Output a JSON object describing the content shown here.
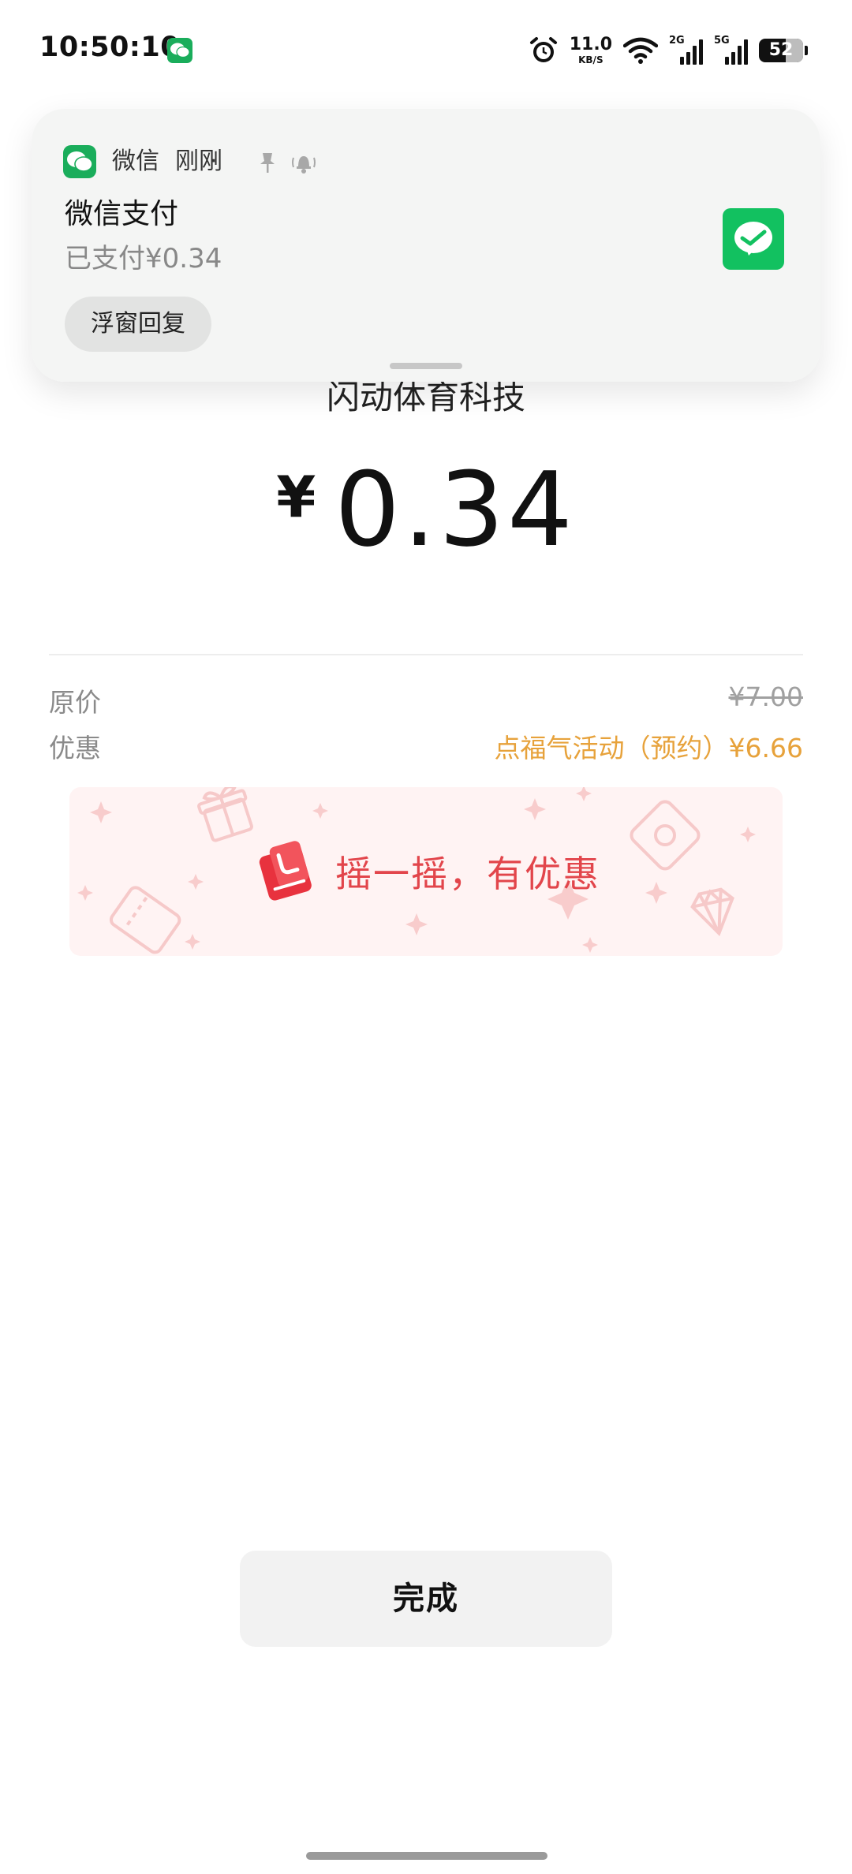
{
  "status_bar": {
    "time": "10:50:10",
    "net_speed_value": "11.0",
    "net_speed_unit": "KB/S",
    "signal_1_label": "2G",
    "signal_2_label": "5G",
    "battery": "52"
  },
  "payment": {
    "merchant": "闪动体育科技",
    "currency_symbol": "¥",
    "amount": "0.34",
    "original_price_label": "原价",
    "original_price": "¥7.00",
    "discount_label": "优惠",
    "discount_value": "点福气活动（预约）¥6.66"
  },
  "shake_banner": {
    "text": "摇一摇，有优惠"
  },
  "notification": {
    "app_name": "微信",
    "separator": "·",
    "time": "刚刚",
    "title": "微信支付",
    "body": "已支付¥0.34",
    "reply_button": "浮窗回复"
  },
  "done_button": "完成",
  "colors": {
    "wechat_green": "#1aad5b",
    "pay_green": "#12c160",
    "discount_orange": "#e7a23b",
    "shake_red": "#e2454b"
  }
}
